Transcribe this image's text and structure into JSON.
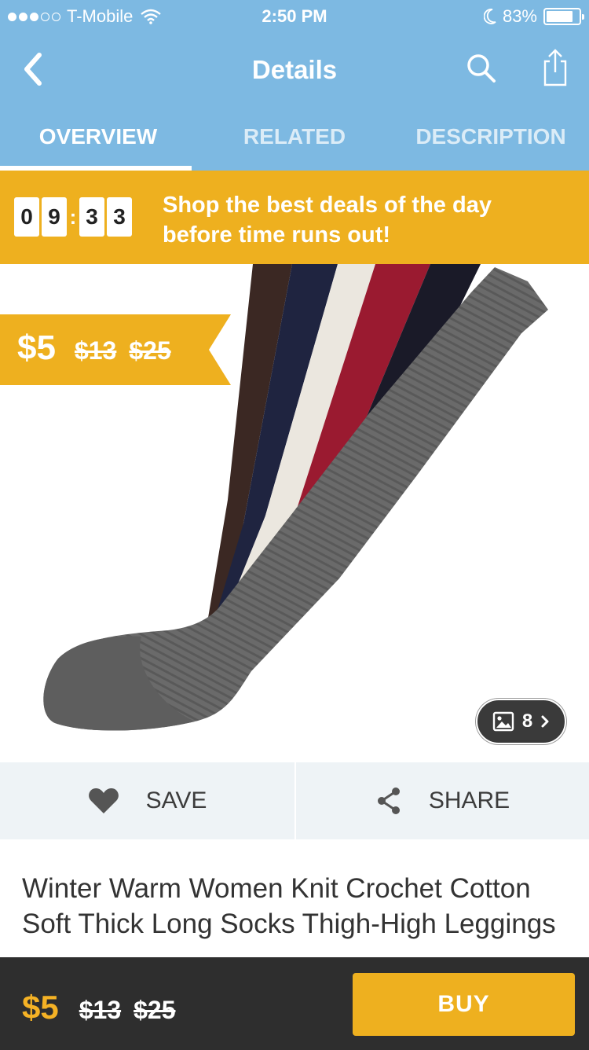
{
  "status_bar": {
    "carrier": "T-Mobile",
    "time": "2:50 PM",
    "battery": "83%"
  },
  "nav": {
    "title": "Details"
  },
  "tabs": [
    {
      "label": "OVERVIEW"
    },
    {
      "label": "RELATED"
    },
    {
      "label": "DESCRIPTION"
    }
  ],
  "deal": {
    "countdown": {
      "d1": "0",
      "d2": "9",
      "d3": "3",
      "d4": "3"
    },
    "line1": "Shop the best deals of the day",
    "line2": "before time runs out!"
  },
  "prices": {
    "current": "$5",
    "original_1": "$13",
    "original_2": "$25"
  },
  "gallery": {
    "count": "8"
  },
  "actions": {
    "save_label": "SAVE",
    "share_label": "SHARE"
  },
  "product": {
    "title": "Winter Warm Women Knit Crochet Cotton Soft Thick Long Socks Thigh-High Leggings"
  },
  "buy_label": "BUY",
  "colors": {
    "header_blue": "#7db9e2",
    "accent_yellow": "#eeb01f",
    "bottom_bar": "#2e2e2e",
    "sock_colors": [
      "#3b2823",
      "#1f2440",
      "#ebe7df",
      "#9a1a30",
      "#1a1a28",
      "#6a6a6a"
    ]
  },
  "icons": {
    "back": "chevron-left-icon",
    "search": "search-icon",
    "share_top": "share-upload-icon",
    "gallery": "image-icon",
    "save": "heart-icon",
    "share": "share-nodes-icon"
  }
}
